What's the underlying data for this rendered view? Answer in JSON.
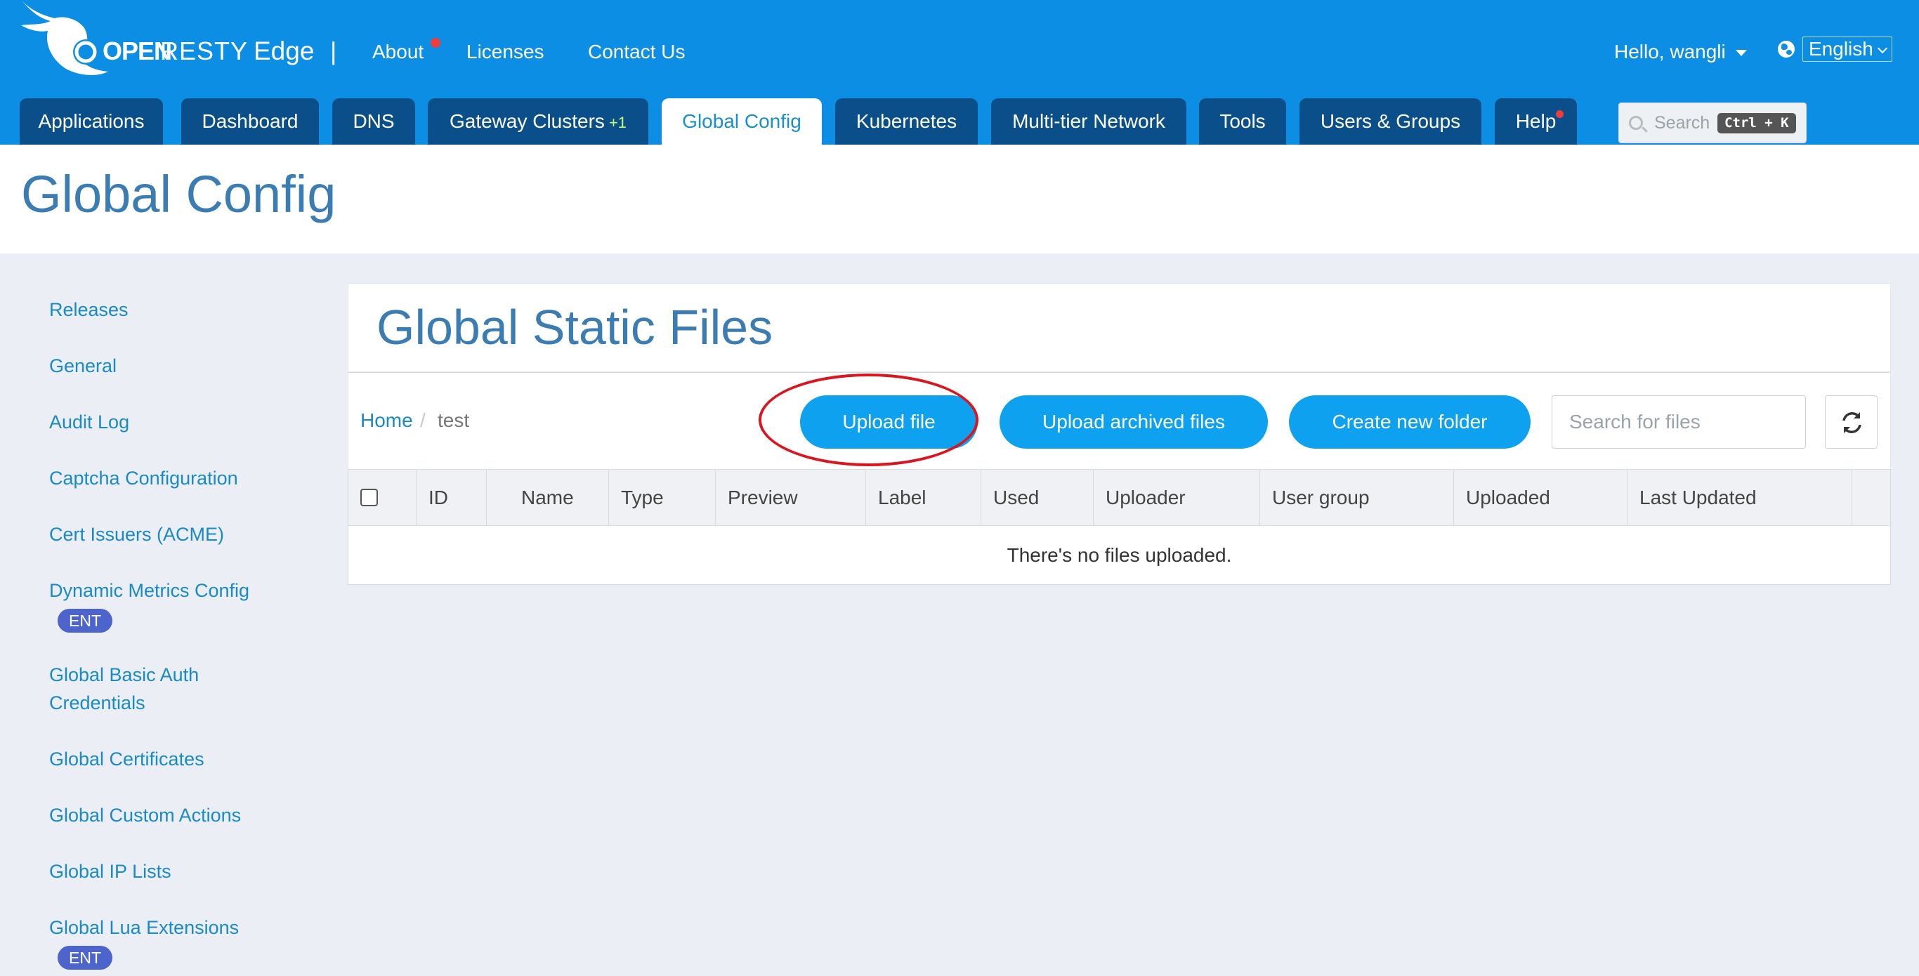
{
  "header": {
    "logo_open": "OPEN",
    "logo_resty": "RESTY",
    "logo_product": "Edge",
    "divider": "|",
    "links": [
      {
        "label": "About",
        "notify": true
      },
      {
        "label": "Licenses",
        "notify": false
      },
      {
        "label": "Contact Us",
        "notify": false
      }
    ],
    "user_greeting": "Hello, wangli",
    "language": "English",
    "accent_color": "#0d8ee5"
  },
  "nav": {
    "tabs": [
      {
        "label": "Applications",
        "active": false
      },
      {
        "label": "Dashboard",
        "active": false
      },
      {
        "label": "DNS",
        "active": false
      },
      {
        "label": "Gateway Clusters",
        "badge": "+1",
        "active": false
      },
      {
        "label": "Global Config",
        "active": true
      },
      {
        "label": "Kubernetes",
        "active": false
      },
      {
        "label": "Multi-tier Network",
        "active": false
      },
      {
        "label": "Tools",
        "active": false
      },
      {
        "label": "Users & Groups",
        "active": false
      },
      {
        "label": "Help",
        "notify": true,
        "active": false
      }
    ],
    "search_placeholder": "Search",
    "search_shortcut": "Ctrl + K"
  },
  "page": {
    "title": "Global Config"
  },
  "sidebar": {
    "items": [
      {
        "label": "Releases"
      },
      {
        "label": "General"
      },
      {
        "label": "Audit Log"
      },
      {
        "label": "Captcha Configuration"
      },
      {
        "label": "Cert Issuers (ACME)"
      },
      {
        "label": "Dynamic Metrics Config",
        "badge": "ENT"
      },
      {
        "label": "Global Basic Auth Credentials"
      },
      {
        "label": "Global Certificates"
      },
      {
        "label": "Global Custom Actions"
      },
      {
        "label": "Global IP Lists"
      },
      {
        "label": "Global Lua Extensions",
        "badge": "ENT"
      }
    ]
  },
  "main": {
    "title": "Global Static Files",
    "breadcrumb": {
      "home": "Home",
      "separator": "/",
      "current": "test"
    },
    "buttons": {
      "upload_file": "Upload file",
      "upload_archived": "Upload archived files",
      "create_folder": "Create new folder"
    },
    "search_placeholder": "Search for files",
    "refresh_icon": "refresh-icon",
    "table": {
      "columns": [
        "ID",
        "Name",
        "Type",
        "Preview",
        "Label",
        "Used",
        "Uploader",
        "User group",
        "Uploaded",
        "Last Updated"
      ],
      "empty_message": "There's no files uploaded."
    }
  }
}
